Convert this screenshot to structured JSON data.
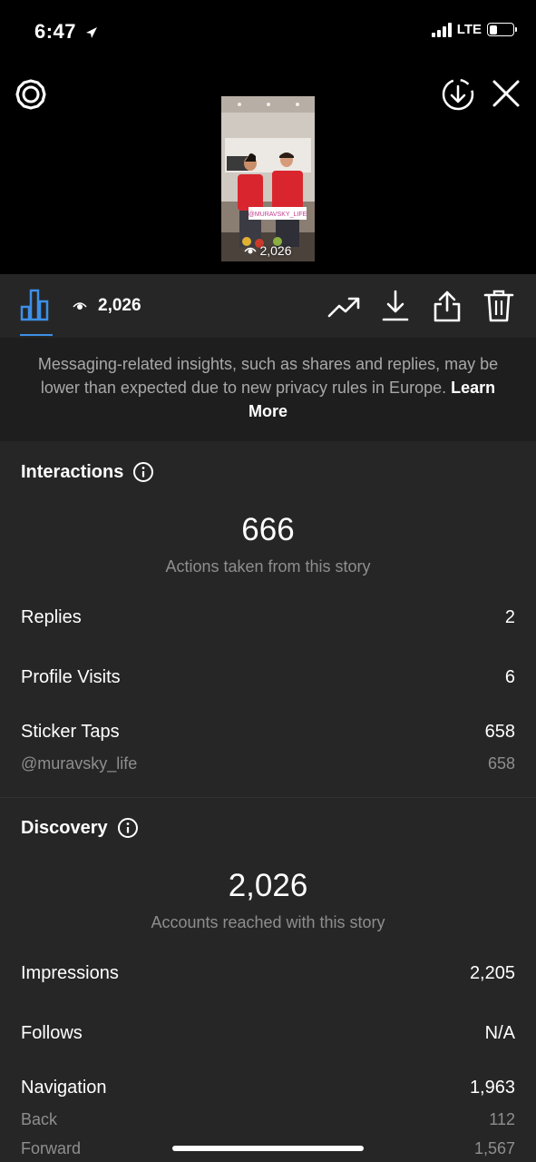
{
  "status_bar": {
    "time": "6:47",
    "network": "LTE",
    "location_icon": "location-arrow-icon",
    "battery_level": 0.35
  },
  "story": {
    "view_count": "2,026",
    "sticker_handle": "@MURAVSKY_LIFE"
  },
  "notice": {
    "text": "Messaging-related insights, such as shares and replies, may be lower than expected due to new privacy rules in Europe.",
    "link": "Learn More"
  },
  "interactions": {
    "title": "Interactions",
    "total": "666",
    "caption": "Actions taken from this story",
    "rows": [
      {
        "label": "Replies",
        "value": "2"
      },
      {
        "label": "Profile Visits",
        "value": "6"
      },
      {
        "label": "Sticker Taps",
        "value": "658"
      }
    ],
    "sub_rows": [
      {
        "label": "@muravsky_life",
        "value": "658"
      }
    ]
  },
  "discovery": {
    "title": "Discovery",
    "total": "2,026",
    "caption": "Accounts reached with this story",
    "rows": [
      {
        "label": "Impressions",
        "value": "2,205"
      },
      {
        "label": "Follows",
        "value": "N/A"
      },
      {
        "label": "Navigation",
        "value": "1,963"
      }
    ],
    "sub_rows": [
      {
        "label": "Back",
        "value": "112"
      },
      {
        "label": "Forward",
        "value": "1,567"
      }
    ]
  },
  "colors": {
    "accent": "#3d90e8",
    "background": "#262626",
    "notice_bg": "#1e1e1e",
    "muted_text": "#8e8e8e"
  }
}
